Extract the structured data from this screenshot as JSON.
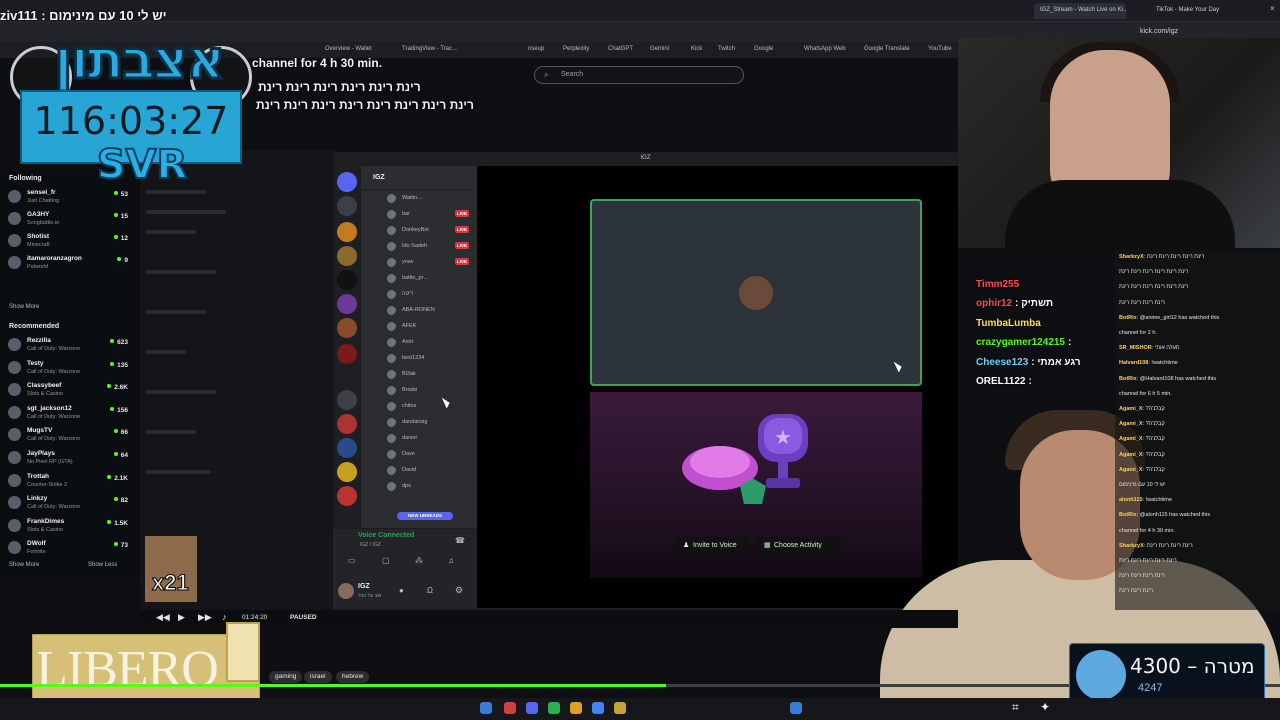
{
  "browser": {
    "tabs": [
      {
        "label": "IGZ_Stream - Watch Live on Ki…",
        "active": true
      },
      {
        "label": "TikTok - Make Your Day",
        "active": false
      }
    ],
    "url": "kick.com/igz",
    "bookmarks": [
      "Overview - Wallet",
      "TradingView - Trac…",
      "nseup",
      "Perplexity",
      "ChatGPT",
      "Gemini",
      "Kick",
      "Twitch",
      "Google",
      "WhatsApp Web",
      "Google Translate",
      "YouTube"
    ],
    "search_placeholder": "Search"
  },
  "overlay": {
    "top_chat": "ziv111 : יש לי 10 עם מינימום",
    "logo_text": "אצבתון",
    "timer": "116:03:27",
    "timer_label": "SVR",
    "hebrew_lines": [
      "channel for 4 h 30 min.",
      "רינת רינת רינת רינת רינת רינת",
      "רינת רינת רינת רינת רינת רינת רינת רינת"
    ]
  },
  "kick_sidebar": {
    "following_title": "Following",
    "following": [
      {
        "name": "sensei_fr",
        "game": "Just Chatting",
        "viewers": "53"
      },
      {
        "name": "GA3HY",
        "game": "Songbattle.io",
        "viewers": "15"
      },
      {
        "name": "Shotist",
        "game": "Minecraft",
        "viewers": "12"
      },
      {
        "name": "itamaroranzagron",
        "game": "Palworld",
        "viewers": "9"
      }
    ],
    "show_more": "Show More",
    "recommended_title": "Recommended",
    "recommended": [
      {
        "name": "Rezzilla",
        "game": "Call of Duty: Warzone",
        "viewers": "623"
      },
      {
        "name": "Testy",
        "game": "Call of Duty: Warzone",
        "viewers": "135"
      },
      {
        "name": "Classybeef",
        "game": "Slots & Casino",
        "viewers": "2.6K"
      },
      {
        "name": "sgt_jackson12",
        "game": "Call of Duty: Warzone",
        "viewers": "156"
      },
      {
        "name": "MugsTV",
        "game": "Call of Duty: Warzone",
        "viewers": "66"
      },
      {
        "name": "JayPlays",
        "game": "No Pixel RP (GTA)",
        "viewers": "64"
      },
      {
        "name": "Trottah",
        "game": "Counter-Strike 2",
        "viewers": "2.1K"
      },
      {
        "name": "Linkzy",
        "game": "Call of Duty: Warzone",
        "viewers": "82"
      },
      {
        "name": "FrankDimes",
        "game": "Slots & Casino",
        "viewers": "1.5K"
      },
      {
        "name": "DWolf",
        "game": "Fortnite",
        "viewers": "73"
      }
    ],
    "show_more_2": "Show More",
    "show_less": "Show Less"
  },
  "discord": {
    "window_title": "IGZ",
    "server_name": "IGZ",
    "voice_users": [
      {
        "name": "Waitin…",
        "live": false
      },
      {
        "name": "bar",
        "live": true
      },
      {
        "name": "DonkeyBoi",
        "live": true
      },
      {
        "name": "Ido Sadeh",
        "live": true
      },
      {
        "name": "yoav",
        "live": true
      },
      {
        "name": "battle_pr…",
        "live": false
      },
      {
        "name": "ריטה",
        "live": false
      },
      {
        "name": "ABA-RONEN",
        "live": false
      },
      {
        "name": "AFEK",
        "live": false
      },
      {
        "name": "Amit",
        "live": false
      },
      {
        "name": "besi1234",
        "live": false
      },
      {
        "name": "Bl3ak",
        "live": false
      },
      {
        "name": "Broski",
        "live": false
      },
      {
        "name": "chitos",
        "live": false
      },
      {
        "name": "dandansig",
        "live": false
      },
      {
        "name": "daniel",
        "live": false
      },
      {
        "name": "Dave",
        "live": false
      },
      {
        "name": "David",
        "live": false
      },
      {
        "name": "dps",
        "live": false
      }
    ],
    "new_unreads": "NEW UNREADS",
    "voice_connected": "Voice Connected",
    "voice_sub": "IGZ / IGZ",
    "username": "IGZ",
    "user_status": "שב על הכל",
    "invite_label": "Invite to Voice",
    "activity_label": "Choose Activity"
  },
  "right_chat_large": [
    {
      "name": "Timm255",
      "color": "#ff4b4b",
      "msg": ""
    },
    {
      "name": "ophir12",
      "color": "#ff4b4b",
      "msg": ": תשתיק"
    },
    {
      "name": "TumbaLumba",
      "color": "#ffe14d",
      "msg": ""
    },
    {
      "name": "crazygamer124215",
      "color": "#53fc18",
      "msg": ":"
    },
    {
      "name": "Cheese123",
      "color": "#6ad5ff",
      "msg": ": רגע אמתי"
    },
    {
      "name": "OREL1122",
      "color": "#ffffff",
      "msg": ":"
    }
  ],
  "right_chat_small": [
    {
      "name": "SharkzyX",
      "msg": "רינת רינת רינת רינת רינת"
    },
    {
      "name": "",
      "msg": "רינת רינת רינת רינת רינת רינת"
    },
    {
      "name": "",
      "msg": "רינת רינת רינת רינת רינת רינת"
    },
    {
      "name": "",
      "msg": "רינת רינת רינת רינת"
    },
    {
      "name": "BotRix",
      "msg": "@anime_girl12 has watched this"
    },
    {
      "name": "",
      "msg": "channel for 2 h."
    },
    {
      "name": "SR_MISHOR",
      "msg": "תעלה אותי"
    },
    {
      "name": "Halvard108",
      "msg": "!watchtime"
    },
    {
      "name": "BotRix",
      "msg": "@Halvard108 has watched this"
    },
    {
      "name": "",
      "msg": "channel for 6 h 5 min."
    },
    {
      "name": "Agami_X",
      "msg": "?קבלנ'ה"
    },
    {
      "name": "Agami_X",
      "msg": "?קבלנ'ה"
    },
    {
      "name": "Agami_X",
      "msg": "?קבלנ'ה"
    },
    {
      "name": "Agami_X",
      "msg": "?קבלנ'ה"
    },
    {
      "name": "Agami_X",
      "msg": "?קבלנ'ה"
    },
    {
      "name": "",
      "msg": "יש לי 10 עם מינימום"
    },
    {
      "name": "alonh115",
      "msg": "!watchtime"
    },
    {
      "name": "BotRix",
      "msg": "@alonh115 has watched this"
    },
    {
      "name": "",
      "msg": "channel for 4 h 30 min."
    },
    {
      "name": "SharkzyX",
      "msg": "רינת רינת רינת רינת"
    },
    {
      "name": "",
      "msg": "רינת רינת רינת רינת רינת"
    },
    {
      "name": "",
      "msg": "רינת רינת רינת רינת"
    },
    {
      "name": "",
      "msg": "רינת רינת רינת"
    }
  ],
  "player": {
    "timecode": "01:24:20",
    "status": "PAUSED",
    "progress_fraction": 0.52
  },
  "tags": [
    "gaming",
    "israel",
    "hebrew"
  ],
  "ad": {
    "brand": "LIBERO"
  },
  "goal": {
    "value": "4300",
    "label": "מטרה",
    "sub": "4247"
  },
  "emote_multiplier": "x21",
  "colors": {
    "kick_green": "#53fc18",
    "discord_bg": "#1e1f22",
    "timer_bg": "#27a6d6",
    "live_red": "#da373c"
  }
}
